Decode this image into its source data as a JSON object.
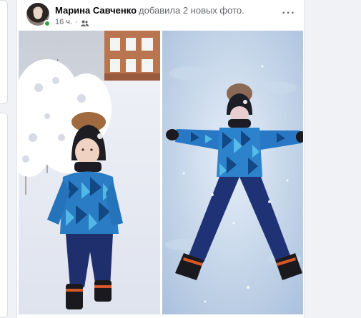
{
  "post": {
    "author_name": "Марина Савченко",
    "action_text": "добавила 2 новых фото.",
    "timestamp": "16 ч.",
    "separator": "·",
    "audience_icon": "friends-icon",
    "more_label": "···"
  },
  "photos": [
    {
      "name": "child-in-snow-photo",
      "scene": "boy in winter jacket standing among snowy trees"
    },
    {
      "name": "snow-angel-photo",
      "scene": "boy lying in snow making a snow angel"
    }
  ],
  "colors": {
    "card_bg": "#ffffff",
    "page_bg": "#f0f2f5",
    "secondary_text": "#65676b",
    "online_green": "#31a24c"
  }
}
